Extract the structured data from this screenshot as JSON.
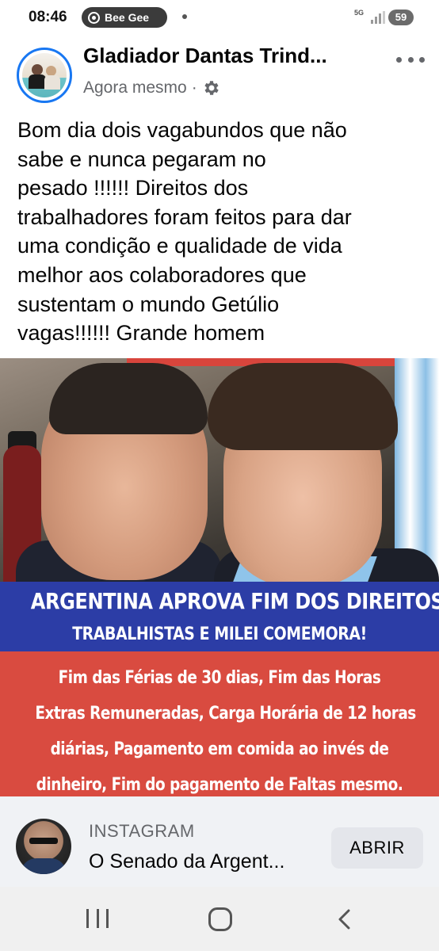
{
  "status_bar": {
    "time": "08:46",
    "notification": "Bee Gee",
    "network": "5G",
    "battery": "59"
  },
  "post": {
    "author": "Gladiador Dantas Trind...",
    "timestamp": "Agora mesmo",
    "separator": "·",
    "privacy_icon": "gear-icon",
    "text_lines": [
      "Bom dia dois vagabundos que não",
      "sabe e nunca pegaram no",
      "pesado !!!!!! Direitos dos",
      "trabalhadores foram feitos para dar",
      "uma condição e qualidade de vida",
      "melhor aos colaboradores que",
      "sustentam o mundo Getúlio",
      "vagas!!!!!! Grande homem"
    ]
  },
  "image": {
    "headline_line1": "ARGENTINA APROVA FIM DOS DIREITOS",
    "headline_line2": "TRABALHISTAS E MILEI COMEMORA!",
    "sub_lines": [
      "Fim das Férias de 30 dias, Fim das Horas",
      "Extras Remuneradas, Carga Horária de 12 horas",
      "diárias, Pagamento em comida ao invés de",
      "dinheiro, Fim do pagamento de Faltas mesmo."
    ],
    "colors": {
      "headline_band": "#2c3da6",
      "sub_band": "#d94b40"
    }
  },
  "link_preview": {
    "source": "INSTAGRAM",
    "title": "O Senado da Argent...",
    "button_label": "ABRIR"
  },
  "colors": {
    "accent": "#1877f2",
    "secondary_text": "#65676b"
  }
}
